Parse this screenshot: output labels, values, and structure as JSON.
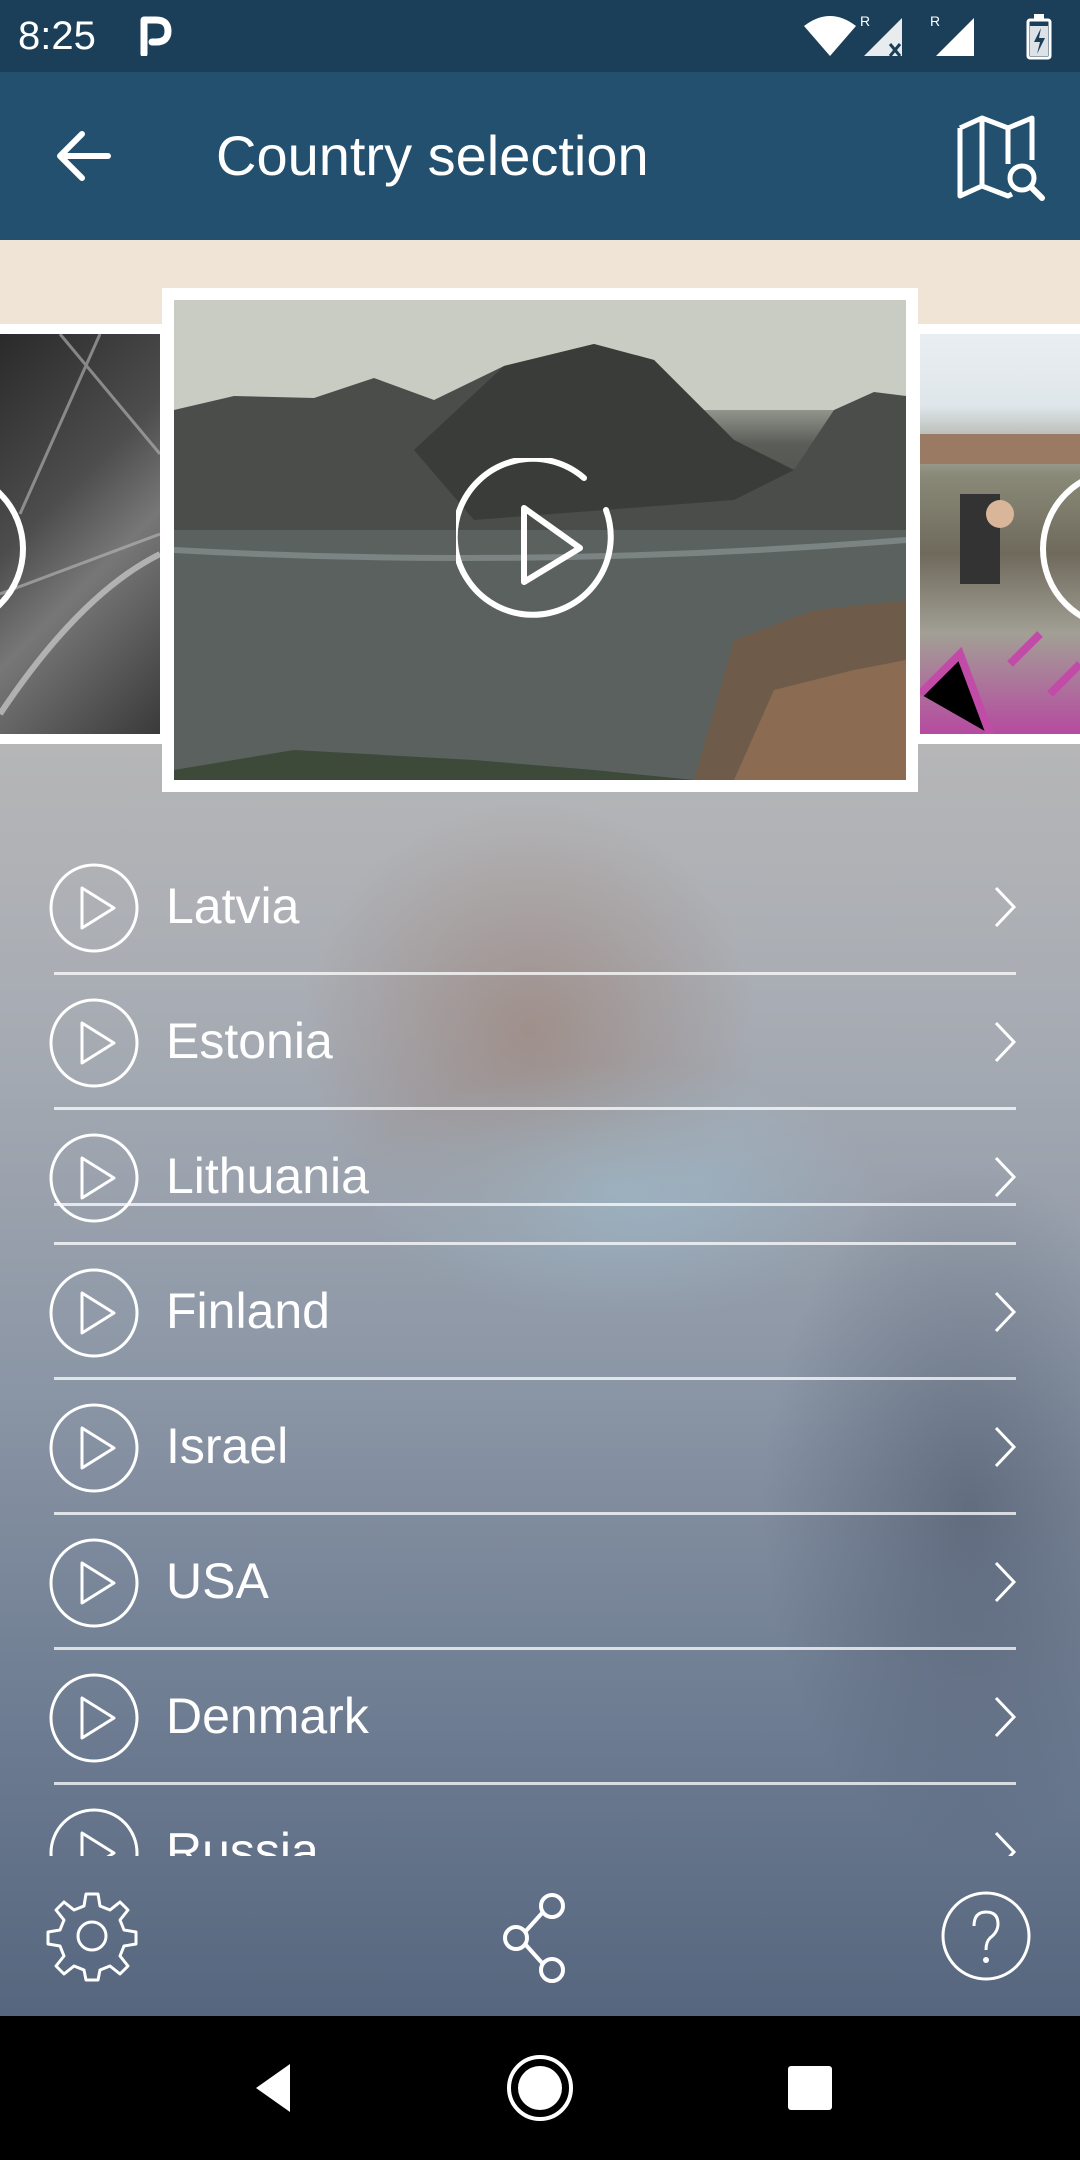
{
  "status_bar": {
    "time": "8:25",
    "notification_icon": "parking-p-icon",
    "icons": [
      "wifi-icon",
      "signal-roaming-x-icon",
      "signal-roaming-icon",
      "battery-charging-icon"
    ]
  },
  "app_bar": {
    "title": "Country selection",
    "back_icon": "arrow-left-icon",
    "map_icon": "map-search-icon"
  },
  "carousel": {
    "items": [
      {
        "description_icon": "play-circle-icon",
        "position": "left-partial"
      },
      {
        "description_icon": "play-circle-icon",
        "position": "center"
      },
      {
        "description_icon": "play-circle-icon",
        "position": "right-partial"
      }
    ]
  },
  "countries": [
    {
      "label": "Latvia"
    },
    {
      "label": "Estonia"
    },
    {
      "label": "Lithuania"
    },
    {
      "label": "Finland"
    },
    {
      "label": "Israel"
    },
    {
      "label": "USA"
    },
    {
      "label": "Denmark"
    },
    {
      "label": "Russia"
    }
  ],
  "toolbar": {
    "settings_icon": "gear-icon",
    "share_icon": "share-icon",
    "help_icon": "help-circle-icon"
  },
  "nav_bar": {
    "icons": [
      "back-triangle-icon",
      "home-circle-icon",
      "recents-square-icon"
    ]
  },
  "colors": {
    "status_bar": "#1b3f58",
    "app_bar": "#22506e",
    "accent_text": "#ffffff"
  }
}
